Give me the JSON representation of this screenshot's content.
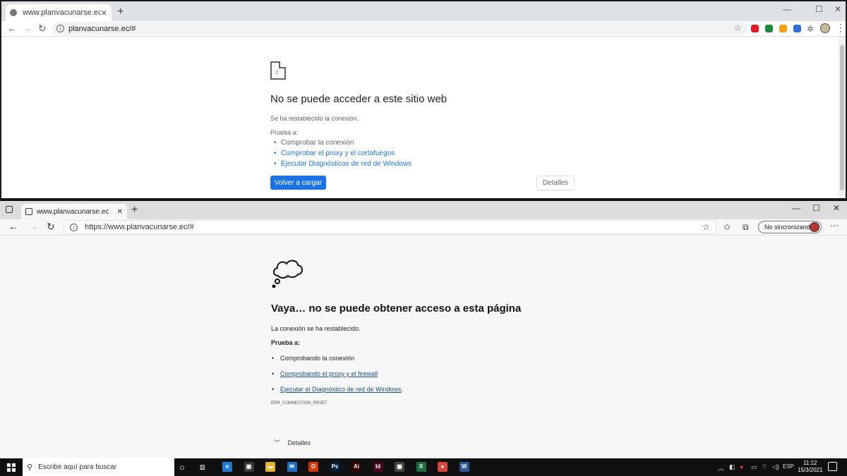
{
  "chrome": {
    "tab_title": "www.planvacunarse.ec",
    "new_tab": "+",
    "url": "planvacunarse.ec/#",
    "error": {
      "title": "No se puede acceder a este sitio web",
      "message": "Se ha restablecido la conexión.",
      "try_label": "Prueba a:",
      "suggestions": [
        "Comprobar la conexión",
        "Comprobar el proxy y el cortafuegos",
        "Ejecutar Diagnósticos de red de Windows"
      ],
      "reload_button": "Volver a cargar",
      "details_button": "Detalles"
    },
    "extension_colors": [
      "#e01b24",
      "#1b8a3a",
      "#f2a20c",
      "#2b6fd6"
    ]
  },
  "edge": {
    "tab_title": "www.planvacunarse.ec",
    "new_tab": "+",
    "url": "https://www.planvacunarse.ec/#",
    "sync_label": "No sincronizando",
    "error": {
      "title": "Vaya… no se puede obtener acceso a esta página",
      "message": "La conexión se ha restablecido.",
      "try_label": "Prueba a:",
      "suggestions": [
        "Comprobando la conexión",
        "Comprobando el proxy y el firewall",
        "Ejecutar el Diagnóstico de red de Windows"
      ],
      "suggestion_suffix": ".",
      "error_code": "ERR_CONNECTION_RESET",
      "details_label": "Detalles"
    }
  },
  "taskbar": {
    "search_placeholder": "Escribe aquí para buscar",
    "language": "ESP",
    "time": "11:12",
    "date": "15/3/2021",
    "apps": [
      {
        "name": "edge",
        "label": "e",
        "color": "#1e7bd6"
      },
      {
        "name": "store",
        "label": "▣",
        "color": "#3a3a3a"
      },
      {
        "name": "explorer",
        "label": "▬",
        "color": "#e8b62a"
      },
      {
        "name": "mail",
        "label": "✉",
        "color": "#1f6fc4"
      },
      {
        "name": "office",
        "label": "O",
        "color": "#d83b01"
      },
      {
        "name": "photoshop",
        "label": "Ps",
        "color": "#001e36"
      },
      {
        "name": "illustrator",
        "label": "Ai",
        "color": "#330000"
      },
      {
        "name": "indesign",
        "label": "Id",
        "color": "#49021f"
      },
      {
        "name": "calculator",
        "label": "▦",
        "color": "#444"
      },
      {
        "name": "excel",
        "label": "X",
        "color": "#1d6f42"
      },
      {
        "name": "chrome",
        "label": "●",
        "color": "#db4437"
      },
      {
        "name": "word",
        "label": "W",
        "color": "#2b579a"
      }
    ]
  }
}
